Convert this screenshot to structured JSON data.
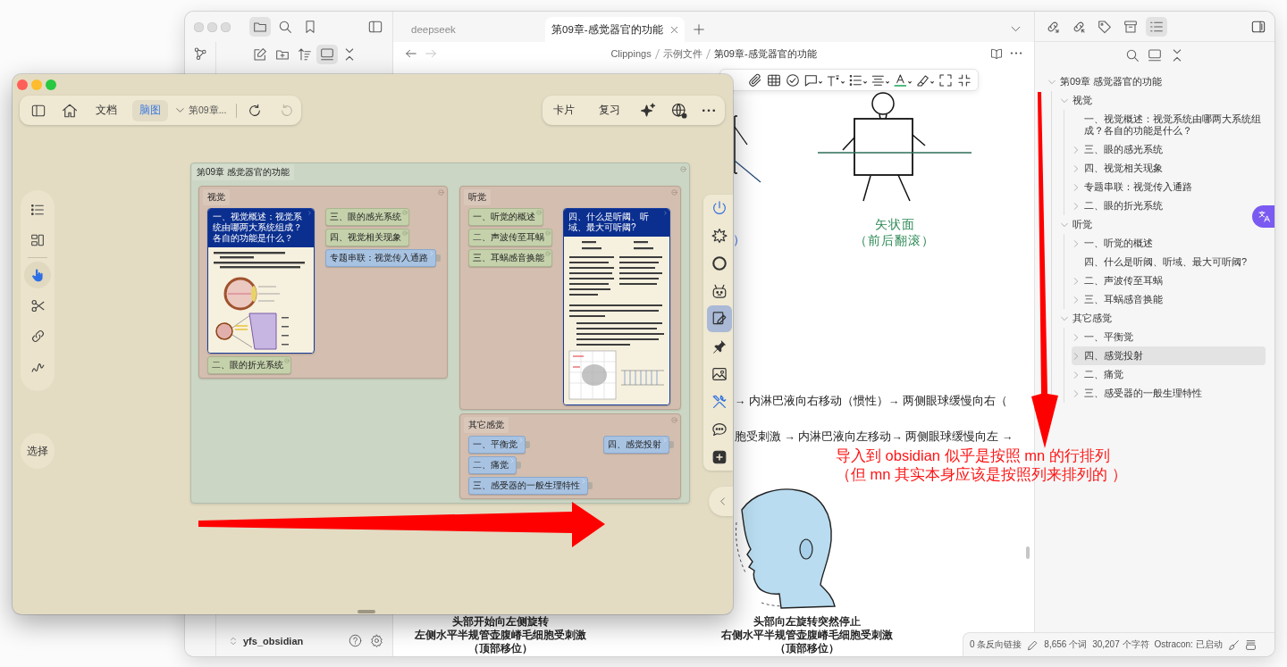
{
  "obsidian": {
    "left_sidebar": {
      "view_buttons": [
        {
          "selected": true
        },
        {
          "selected": false
        },
        {
          "selected": false
        }
      ],
      "action_buttons": [
        {
          "selected": false
        },
        {
          "selected": false
        },
        {
          "selected": false
        },
        {
          "selected": true
        },
        {
          "selected": false
        }
      ],
      "vault": "yfs_obsidian"
    },
    "tabs": [
      {
        "label": "deepseek",
        "selected": false
      },
      {
        "label": "第09章-感觉器官的功能",
        "selected": true
      }
    ],
    "breadcrumb": [
      "Clippings",
      "示例文件",
      "第09章-感觉器官的功能"
    ],
    "document": {
      "caption_fragment": "）",
      "figure_caption": [
        "矢状面",
        "（前后翻滚）"
      ],
      "lines": [
        "→ 内淋巴液向右移动（惯性）→ 两侧眼球缓慢向右（",
        "胞受刺激 → 内淋巴液向左移动→ 两侧眼球缓慢向左 →"
      ],
      "head_figures": [
        {
          "caption": [
            "头部开始向左侧旋转",
            "左侧水平半规管壶腹嵴毛细胞受刺激",
            "（顶部移位）"
          ]
        },
        {
          "caption": [
            "头部向左旋转突然停止",
            "右侧水平半规管壶腹嵴毛细胞受刺激",
            "（顶部移位）"
          ]
        }
      ]
    },
    "right_sidebar": {
      "view_buttons": [
        {
          "selected": false
        },
        {
          "selected": false
        },
        {
          "selected": false
        },
        {
          "selected": false
        },
        {
          "selected": true
        }
      ],
      "outline": [
        {
          "label": "第09章 感觉器官的功能",
          "kind": "branch",
          "expanded": true,
          "selected": false,
          "children": [
            {
              "label": "视觉",
              "kind": "branch",
              "expanded": true,
              "selected": false,
              "children": [
                {
                  "label": "一、视觉概述：视觉系统由哪两大系统组成？各自的功能是什么？",
                  "kind": "leaf",
                  "selected": false
                },
                {
                  "label": "三、眼的感光系统",
                  "kind": "branch",
                  "expanded": false,
                  "selected": false
                },
                {
                  "label": "四、视觉相关现象",
                  "kind": "branch",
                  "expanded": false,
                  "selected": false
                },
                {
                  "label": "专题串联：视觉传入通路",
                  "kind": "branch",
                  "expanded": false,
                  "selected": false
                },
                {
                  "label": "二、眼的折光系统",
                  "kind": "branch",
                  "expanded": false,
                  "selected": false
                }
              ]
            },
            {
              "label": "听觉",
              "kind": "branch",
              "expanded": true,
              "selected": false,
              "children": [
                {
                  "label": "一、听觉的概述",
                  "kind": "branch",
                  "expanded": false,
                  "selected": false
                },
                {
                  "label": "四、什么是听阈、听域、最大可听阈?",
                  "kind": "leaf",
                  "selected": false
                },
                {
                  "label": "二、声波传至耳蜗",
                  "kind": "branch",
                  "expanded": false,
                  "selected": false
                },
                {
                  "label": "三、耳蜗感音换能",
                  "kind": "branch",
                  "expanded": false,
                  "selected": false
                }
              ]
            },
            {
              "label": "其它感觉",
              "kind": "branch",
              "expanded": true,
              "selected": false,
              "children": [
                {
                  "label": "一、平衡觉",
                  "kind": "branch",
                  "expanded": false,
                  "selected": false
                },
                {
                  "label": "四、感觉投射",
                  "kind": "branch",
                  "expanded": false,
                  "selected": true
                },
                {
                  "label": "二、痛觉",
                  "kind": "branch",
                  "expanded": false,
                  "selected": false
                },
                {
                  "label": "三、感受器的一般生理特性",
                  "kind": "branch",
                  "expanded": false,
                  "selected": false
                }
              ]
            }
          ]
        }
      ]
    },
    "status_bar": {
      "backlinks": "0 条反向链接",
      "words": "8,656 个词",
      "characters": "30,207 个字符",
      "plugin": "Ostracon: 已启动"
    }
  },
  "mindmap_window": {
    "toolbar": {
      "modes": [
        {
          "label": "文档",
          "selected": false
        },
        {
          "label": "脑图",
          "selected": true
        }
      ],
      "document": "第09章...",
      "history": [
        {
          "disabled": false
        },
        {
          "disabled": true
        }
      ]
    },
    "actions": [
      "卡片",
      "复习"
    ],
    "tools": [
      {
        "selected": true
      },
      {
        "selected": false
      },
      {
        "selected": false
      },
      {
        "selected": false
      }
    ],
    "select_button": "选择",
    "side_tools": [
      {
        "selected": false
      },
      {
        "selected": false
      },
      {
        "selected": false
      },
      {
        "selected": false
      },
      {
        "selected": true
      },
      {
        "selected": false
      },
      {
        "selected": false
      },
      {
        "selected": false
      },
      {
        "selected": false
      },
      {
        "selected": false
      }
    ],
    "map": {
      "title": "第09章 感觉器官的功能",
      "columns": [
        [
          {
            "title": "视觉",
            "columns": [
              [
                {
                  "kind": "card",
                  "title": "一、视觉概述：视觉系统由哪两大系统组成？各自的功能是什么？"
                },
                {
                  "kind": "topic",
                  "title": "二、眼的折光系统"
                }
              ],
              [
                {
                  "kind": "topic",
                  "title": "三、眼的感光系统"
                },
                {
                  "kind": "topic",
                  "title": "四、视觉相关现象"
                },
                {
                  "kind": "link",
                  "title": "专题串联：视觉传入通路"
                }
              ]
            ]
          }
        ],
        [
          {
            "title": "听觉",
            "columns": [
              [
                {
                  "kind": "topic",
                  "title": "一、听觉的概述"
                },
                {
                  "kind": "topic",
                  "title": "二、声波传至耳蜗"
                },
                {
                  "kind": "topic",
                  "title": "三、耳蜗感音换能"
                }
              ],
              [
                {
                  "kind": "card",
                  "title": "四、什么是听阈、听域、最大可听阈?"
                }
              ]
            ]
          },
          {
            "title": "其它感觉",
            "columns": [
              [
                {
                  "kind": "link",
                  "title": "一、平衡觉"
                },
                {
                  "kind": "link",
                  "title": "二、痛觉"
                },
                {
                  "kind": "link",
                  "title": "三、感受器的一般生理特性"
                }
              ],
              [
                {
                  "kind": "link",
                  "title": "四、感觉投射"
                }
              ]
            ]
          }
        ]
      ]
    }
  },
  "annotation": {
    "note": [
      "导入到 obsidian 似乎是按照 mn 的行排列",
      "（但 mn 其实本身应该是按照列来排列的 ）"
    ]
  }
}
